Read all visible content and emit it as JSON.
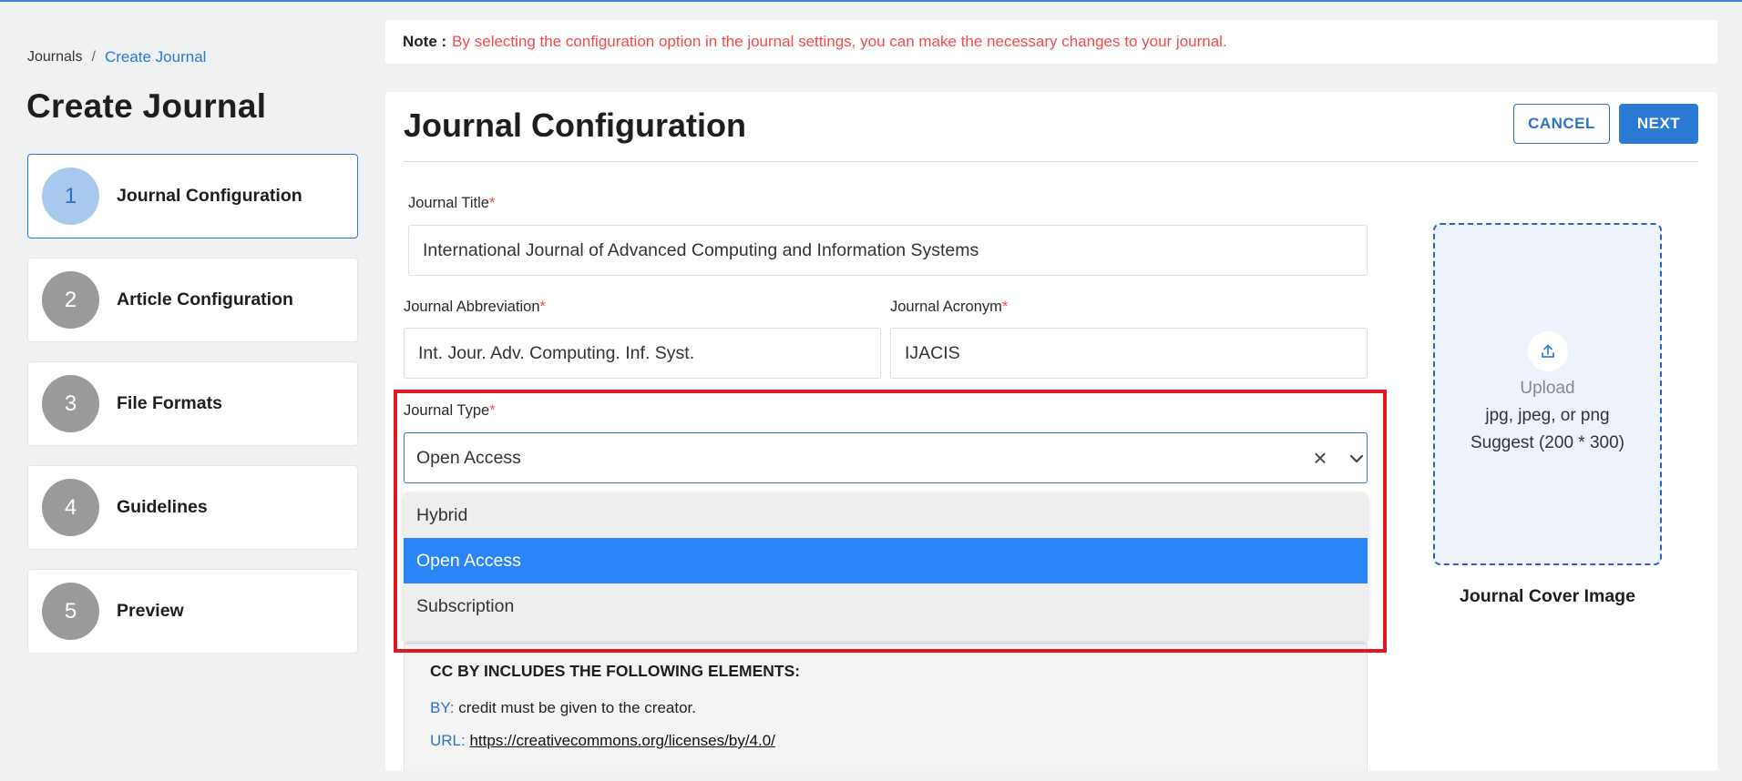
{
  "breadcrumb": {
    "root": "Journals",
    "separator": "/",
    "current": "Create Journal"
  },
  "page_title": "Create Journal",
  "steps": [
    {
      "number": "1",
      "label": "Journal Configuration",
      "active": true
    },
    {
      "number": "2",
      "label": "Article Configuration",
      "active": false
    },
    {
      "number": "3",
      "label": "File Formats",
      "active": false
    },
    {
      "number": "4",
      "label": "Guidelines",
      "active": false
    },
    {
      "number": "5",
      "label": "Preview",
      "active": false
    }
  ],
  "note": {
    "label": "Note :",
    "text": "By selecting the configuration option in the journal settings, you can make the necessary changes to your journal."
  },
  "main": {
    "title": "Journal Configuration",
    "cancel_label": "CANCEL",
    "next_label": "NEXT"
  },
  "form": {
    "required_mark": "*",
    "journal_title": {
      "label": "Journal Title",
      "value": "International Journal of Advanced Computing and Information Systems"
    },
    "journal_abbreviation": {
      "label": "Journal Abbreviation",
      "value": "Int. Jour. Adv. Computing. Inf. Syst."
    },
    "journal_acronym": {
      "label": "Journal Acronym",
      "value": "IJACIS"
    },
    "journal_type": {
      "label": "Journal Type",
      "value": "Open Access",
      "options": [
        "Hybrid",
        "Open Access",
        "Subscription"
      ],
      "selected_index": 1
    }
  },
  "license": {
    "heading": "CC BY INCLUDES THE FOLLOWING ELEMENTS:",
    "by_key": "BY:",
    "by_text": "credit must be given to the creator.",
    "url_key": "URL:",
    "url_text": "https://creativecommons.org/licenses/by/4.0/"
  },
  "upload": {
    "title": "Upload",
    "formats": "jpg, jpeg, or png",
    "suggest": "Suggest (200 * 300)",
    "caption": "Journal Cover Image"
  },
  "colors": {
    "accent": "#2a7ad5",
    "required": "#ef4b4b",
    "selected_option": "#2a86f8",
    "highlight": "#e0191f"
  }
}
